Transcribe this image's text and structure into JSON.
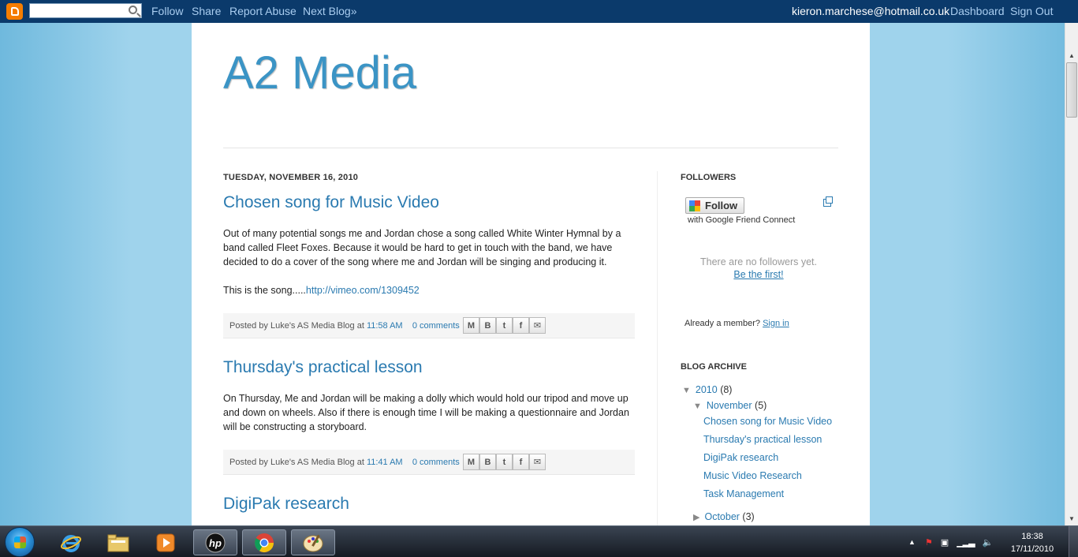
{
  "navbar": {
    "search_placeholder": "",
    "links": [
      "Follow",
      "Share",
      "Report Abuse",
      "Next Blog»"
    ],
    "email": "kieron.marchese@hotmail.co.uk",
    "dashboard": "Dashboard",
    "signout": "Sign Out"
  },
  "blog": {
    "title": "A2 Media"
  },
  "date_header": "TUESDAY, NOVEMBER 16, 2010",
  "posts": [
    {
      "title": "Chosen song for Music Video",
      "paragraphs": [
        "Out of many potential songs me and Jordan chose a song called White Winter Hymnal by a band called Fleet Foxes. Because it would be hard to get in touch with the band, we have decided to do a cover of the song where me and Jordan will be singing and producing it."
      ],
      "song_prefix": "This is the song.....",
      "song_link": "http://vimeo.com/1309452",
      "posted_by": "Posted by Luke's AS Media Blog at",
      "time": "11:58 AM",
      "comments": "0 comments"
    },
    {
      "title": "Thursday's practical lesson",
      "paragraphs": [
        "On Thursday, Me and Jordan will be making a dolly which would hold our tripod and move up and down on wheels. Also if there is enough time I will be making a questionnaire and Jordan will be constructing a storyboard."
      ],
      "posted_by": "Posted by Luke's AS Media Blog at",
      "time": "11:41 AM",
      "comments": "0 comments"
    },
    {
      "title": "DigiPak research"
    }
  ],
  "sidebar": {
    "followers_heading": "FOLLOWERS",
    "follow_button": "Follow",
    "follow_sub": "with Google Friend Connect",
    "no_followers": "There are no followers yet.",
    "be_first": "Be the first!",
    "already_member": "Already a member?",
    "sign_in": "Sign in",
    "archive_heading": "BLOG ARCHIVE",
    "archive": {
      "year": "2010",
      "year_count": "(8)",
      "month": "November",
      "month_count": "(5)",
      "posts": [
        "Chosen song for Music Video",
        "Thursday's practical lesson",
        "DigiPak research",
        "Music Video Research",
        "Task Management"
      ],
      "prev_month": "October",
      "prev_month_count": "(3)"
    }
  },
  "taskbar": {
    "time": "18:38",
    "date": "17/11/2010"
  },
  "colors": {
    "navbar": "#0b3a6b",
    "link": "#2a7ab0",
    "title": "#3b94c5",
    "background": "#9fd3ec"
  }
}
